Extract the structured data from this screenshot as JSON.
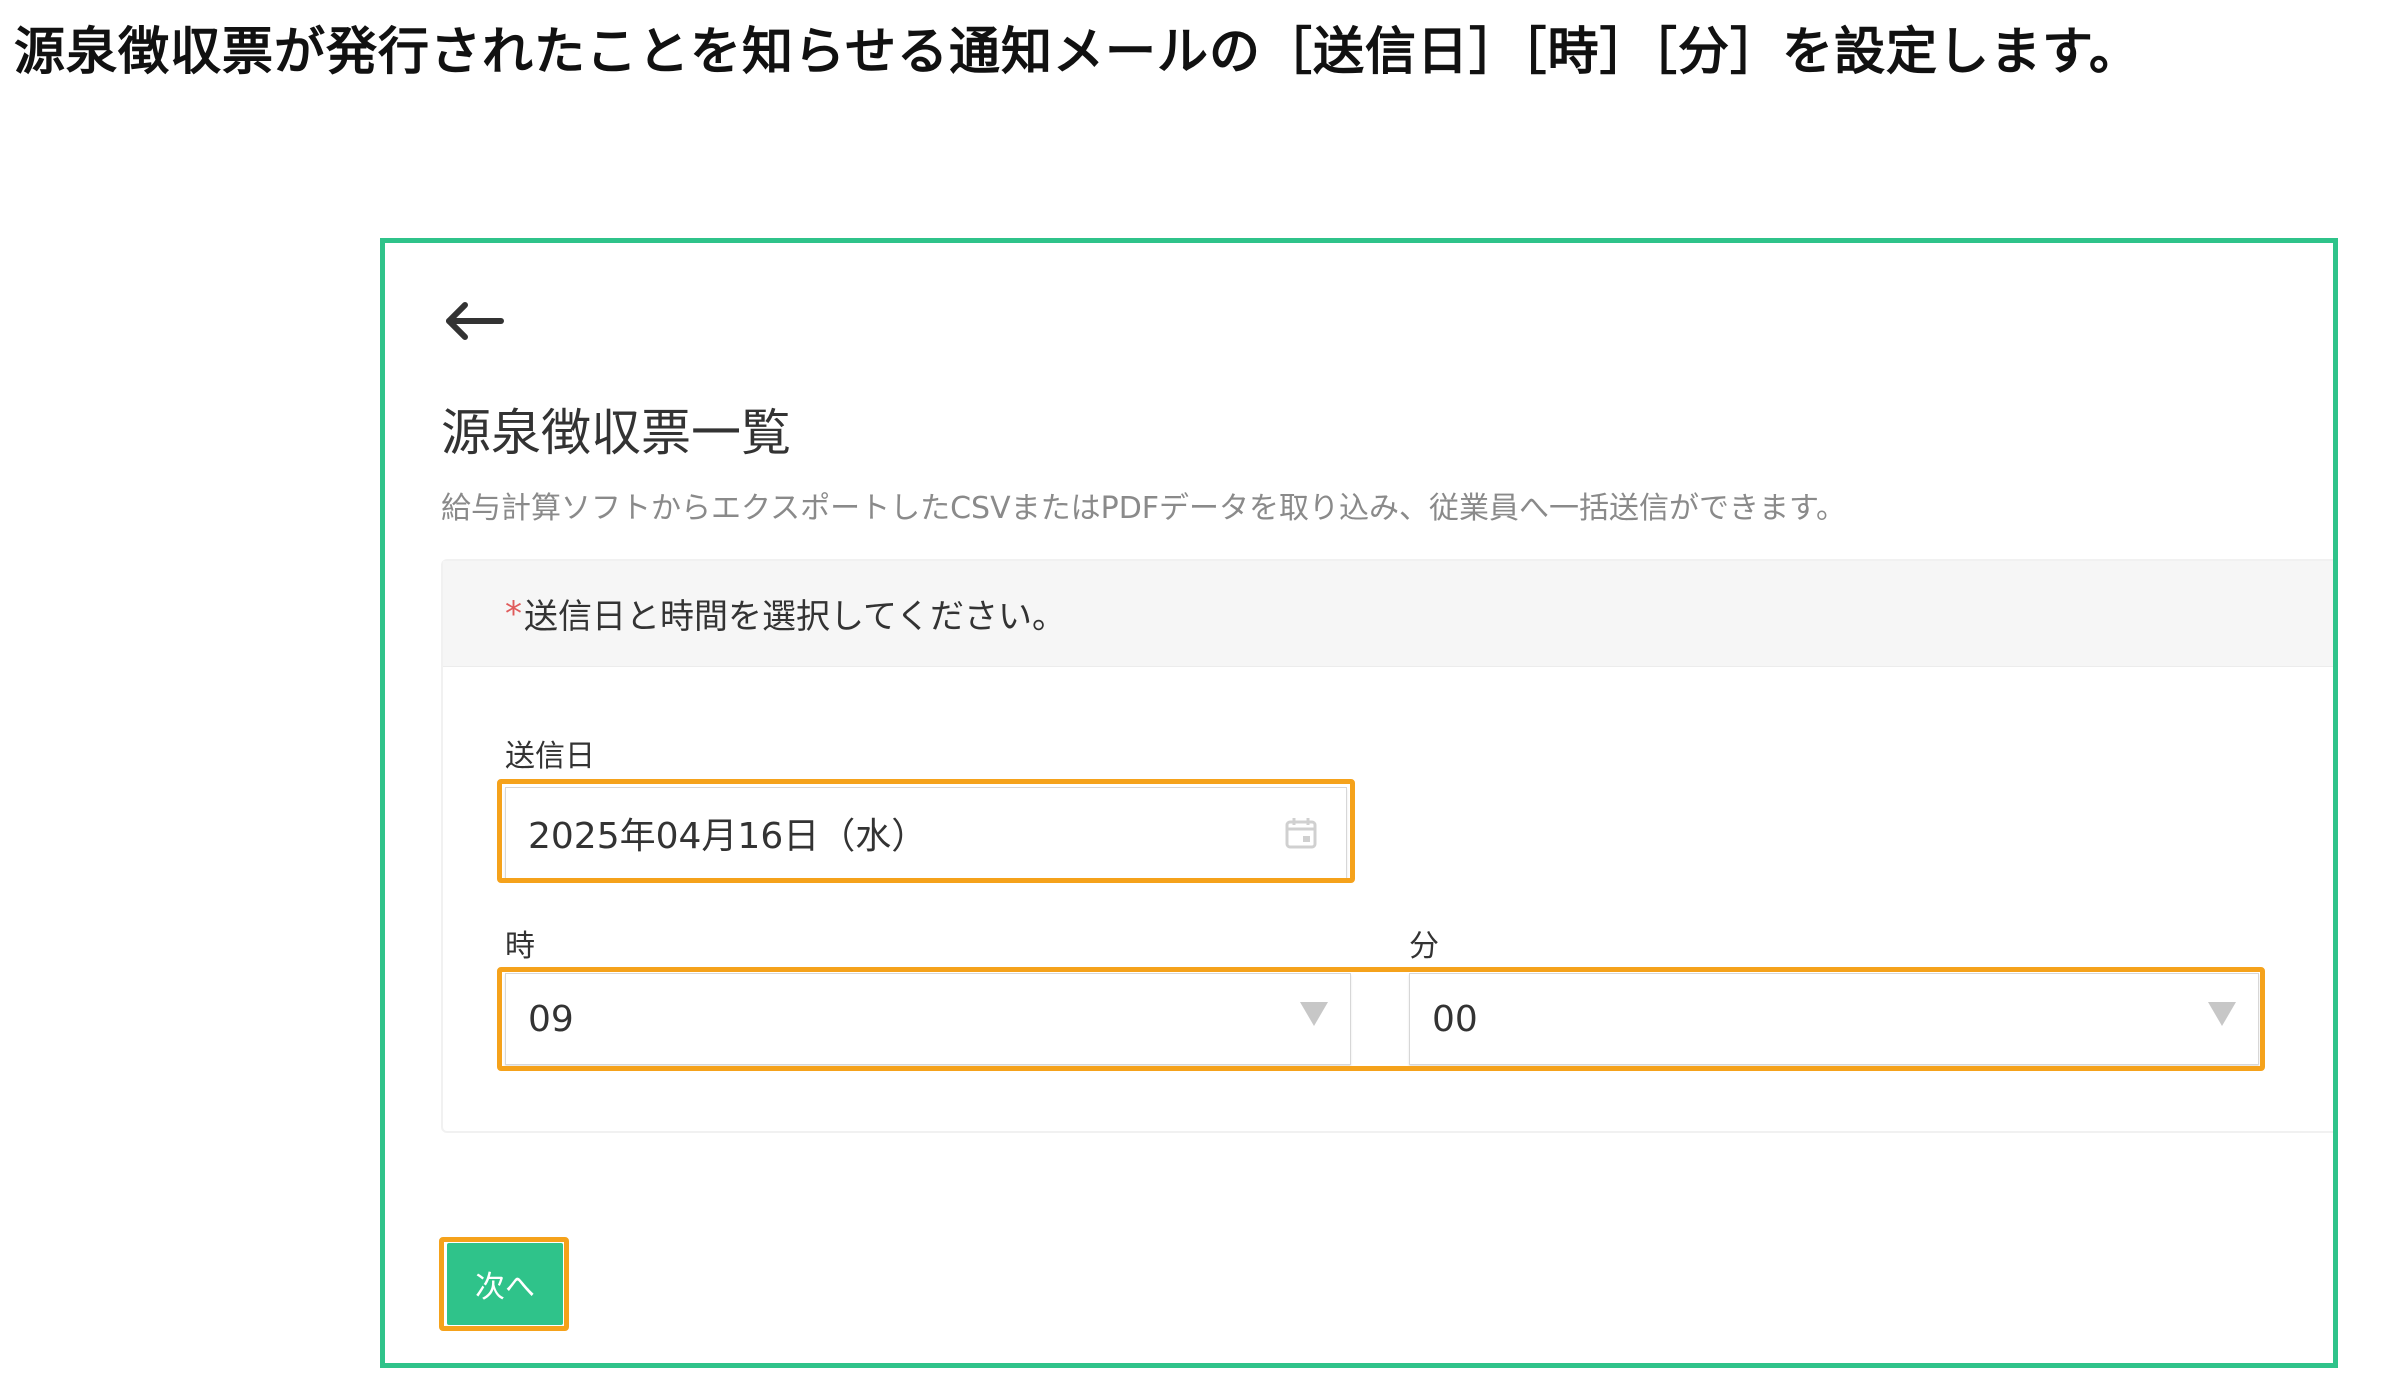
{
  "instruction": {
    "text": "源泉徴収票が発行されたことを知らせる通知メールの［送信日］［時］［分］を設定します。"
  },
  "page": {
    "title": "源泉徴収票一覧",
    "description": "給与計算ソフトからエクスポートしたCSVまたはPDFデータを取り込み、従業員へ一括送信ができます。"
  },
  "form": {
    "required_mark": "*",
    "prompt": "送信日と時間を選択してください。",
    "send_date": {
      "label": "送信日",
      "value": "2025年04月16日（水）"
    },
    "hour": {
      "label": "時",
      "value": "09"
    },
    "minute": {
      "label": "分",
      "value": "00"
    }
  },
  "actions": {
    "next_label": "次へ"
  },
  "icons": {
    "back": "arrow-left-icon",
    "calendar": "calendar-icon",
    "dropdown": "chevron-down-icon"
  },
  "colors": {
    "accent_green": "#2fc38a",
    "highlight_orange": "#f5a21b",
    "required_red": "#e05b5b"
  }
}
